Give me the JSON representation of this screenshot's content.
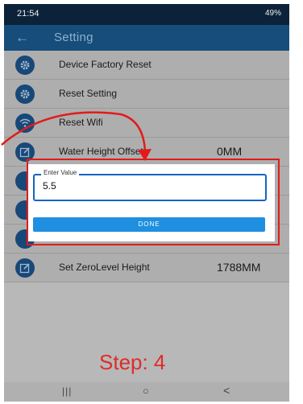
{
  "status_bar": {
    "time": "21:54",
    "right": "49%"
  },
  "app_bar": {
    "back_icon": "arrow-left-icon",
    "title": "Setting"
  },
  "settings": [
    {
      "label": "Device Factory Reset",
      "icon": "gear-icon",
      "value": ""
    },
    {
      "label": "Reset Setting",
      "icon": "gear-icon",
      "value": ""
    },
    {
      "label": "Reset Wifi",
      "icon": "wifi-icon",
      "value": ""
    },
    {
      "label": "Water Height Offset",
      "icon": "edit-icon",
      "value": "0MM"
    },
    {
      "label": "Set ZeroLevel Height",
      "icon": "edit-icon",
      "value": "1788MM"
    }
  ],
  "dialog": {
    "field_label": "Enter Value",
    "field_value": "5.5",
    "done_label": "DONE"
  },
  "step_label": "Step: 4",
  "colors": {
    "app_bar": "#164d7a",
    "accent": "#1565c0",
    "annotation": "#e21b1b"
  }
}
